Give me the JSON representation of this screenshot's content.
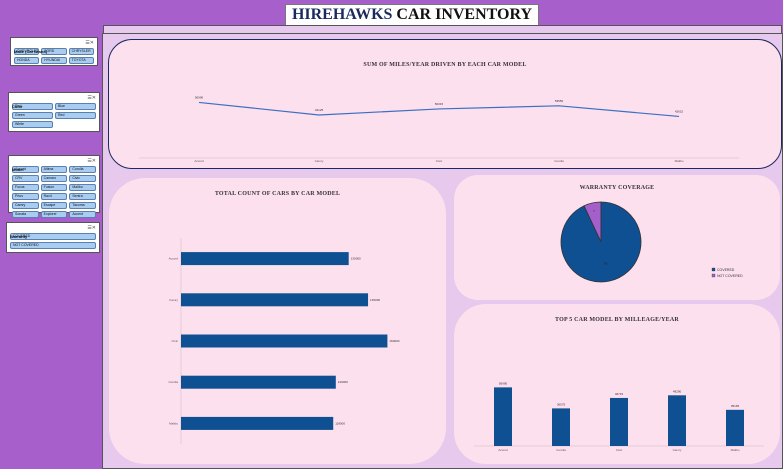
{
  "title": {
    "part1": "HIREHAWKS",
    "part2": "CAR INVENTORY"
  },
  "slicers": [
    {
      "title": "Make (Car Brand)",
      "items": [
        "CHEVROLET",
        "FORD",
        "CHRYSLER",
        "HONDA",
        "HYUNDAI",
        "TOYOTA"
      ]
    },
    {
      "title": "Color",
      "items": [
        "Red",
        "Blue",
        "Green",
        "Red",
        "White"
      ]
    },
    {
      "title": "Model",
      "items": [
        "Accord",
        "Altima",
        "Corolla",
        "CRV",
        "Camaro",
        "Civic",
        "Focus",
        "Fusion",
        "Malibu",
        "Prius",
        "Rav4",
        "Sentra",
        "Camry",
        "Escape",
        "Tacoma",
        "Sonata",
        "Explorer",
        "Accent"
      ]
    },
    {
      "title": "Warranty",
      "items": [
        "COVERED",
        "NOT COVERED"
      ]
    }
  ],
  "chart_data": [
    {
      "type": "line",
      "title": "SUM OF MILES/YEAR DRIVEN BY EACH CAR MODEL",
      "categories": [
        "Accord",
        "Camry",
        "Civic",
        "Corolla",
        "Malibu"
      ],
      "values": [
        56990,
        44125,
        50315,
        53550,
        42615
      ],
      "value_labels": [
        "56990",
        "44125",
        "50315",
        "53550",
        "42615"
      ],
      "ylim": [
        0,
        80000
      ],
      "color": "#3a6fc4"
    },
    {
      "type": "bar",
      "title": "TOTAL COUNT OF CARS BY CAR MODEL",
      "categories": [
        "Accord",
        "Camry",
        "Civic",
        "Corolla",
        "Malibu"
      ],
      "values": [
        130000,
        145000,
        160000,
        120000,
        118000
      ],
      "value_labels": [
        "130000",
        "145000",
        "160000",
        "120000",
        "118000"
      ],
      "xlim": [
        0,
        200000
      ],
      "color": "#0f5093"
    },
    {
      "type": "pie",
      "title": "WARRANTY COVERAGE",
      "labels": [
        "COVERED",
        "NOT COVERED"
      ],
      "values": [
        93,
        7
      ],
      "value_labels": [
        "93",
        "7"
      ],
      "colors": [
        "#0f5093",
        "#a55fcb"
      ],
      "legend": "right"
    },
    {
      "type": "bar",
      "title": "TOP 5 CAR MODEL BY MILLEAGE/YEAR",
      "categories": [
        "Accord",
        "Corolla",
        "Civic",
        "Camry",
        "Malibu"
      ],
      "values": [
        56990,
        36575,
        46715,
        49290,
        35165
      ],
      "value_labels": [
        "56990",
        "36575",
        "46715",
        "49290",
        "35165"
      ],
      "ylim": [
        0,
        70000
      ],
      "color": "#0f5093"
    }
  ]
}
